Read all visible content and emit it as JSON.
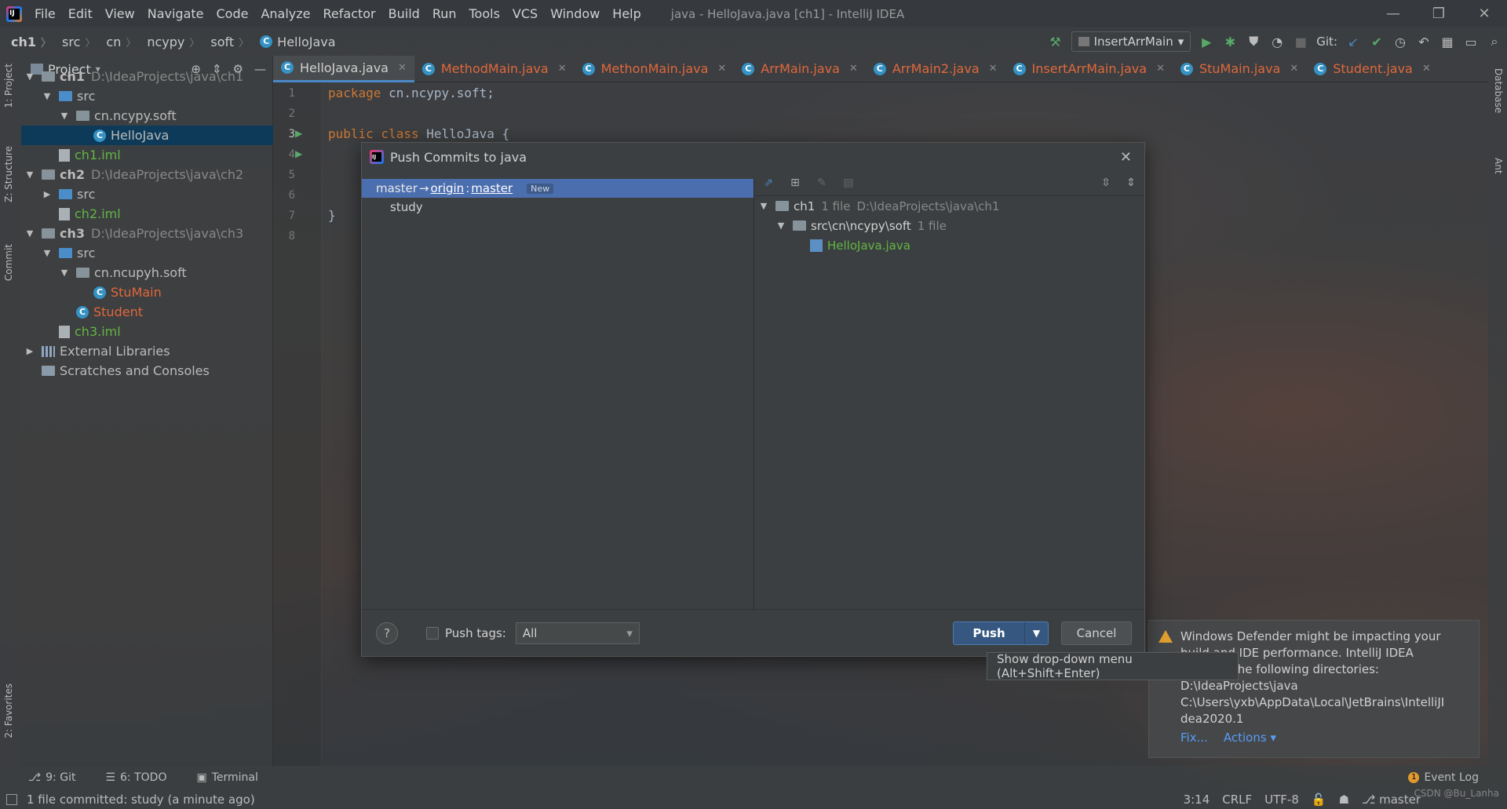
{
  "menubar": {
    "items": [
      "File",
      "Edit",
      "View",
      "Navigate",
      "Code",
      "Analyze",
      "Refactor",
      "Build",
      "Run",
      "Tools",
      "VCS",
      "Window",
      "Help"
    ],
    "window_title": "java - HelloJava.java [ch1] - IntelliJ IDEA"
  },
  "breadcrumb": [
    "ch1",
    "src",
    "cn",
    "ncypy",
    "soft",
    "HelloJava"
  ],
  "toolbar": {
    "run_config": "InsertArrMain",
    "git_label": "Git:"
  },
  "left_strip": {
    "project": "1: Project",
    "structure": "Z: Structure",
    "commit": "Commit",
    "favorites": "2: Favorites"
  },
  "right_strip": {
    "database": "Database",
    "ant": "Ant"
  },
  "project_panel": {
    "title": "Project",
    "tree": [
      {
        "label": "ch1",
        "path": "D:\\IdeaProjects\\java\\ch1",
        "kind": "module",
        "depth": 0,
        "arrow": "▼"
      },
      {
        "label": "src",
        "kind": "src",
        "depth": 1,
        "arrow": "▼"
      },
      {
        "label": "cn.ncypy.soft",
        "kind": "pkg",
        "depth": 2,
        "arrow": "▼"
      },
      {
        "label": "HelloJava",
        "kind": "class",
        "depth": 3,
        "arrow": "",
        "selected": true
      },
      {
        "label": "ch1.iml",
        "kind": "iml",
        "depth": 1,
        "arrow": "",
        "color": "green"
      },
      {
        "label": "ch2",
        "path": "D:\\IdeaProjects\\java\\ch2",
        "kind": "module",
        "depth": 0,
        "arrow": "▼"
      },
      {
        "label": "src",
        "kind": "src",
        "depth": 1,
        "arrow": "▶"
      },
      {
        "label": "ch2.iml",
        "kind": "iml",
        "depth": 1,
        "arrow": "",
        "color": "green"
      },
      {
        "label": "ch3",
        "path": "D:\\IdeaProjects\\java\\ch3",
        "kind": "module",
        "depth": 0,
        "arrow": "▼"
      },
      {
        "label": "src",
        "kind": "src",
        "depth": 1,
        "arrow": "▼"
      },
      {
        "label": "cn.ncupyh.soft",
        "kind": "pkg",
        "depth": 2,
        "arrow": "▼"
      },
      {
        "label": "StuMain",
        "kind": "class",
        "depth": 3,
        "arrow": "",
        "color": "orange"
      },
      {
        "label": "Student",
        "kind": "class",
        "depth": 2,
        "arrow": "",
        "color": "orange"
      },
      {
        "label": "ch3.iml",
        "kind": "iml",
        "depth": 1,
        "arrow": "",
        "color": "green"
      },
      {
        "label": "External Libraries",
        "kind": "lib",
        "depth": 0,
        "arrow": "▶"
      },
      {
        "label": "Scratches and Consoles",
        "kind": "scratch",
        "depth": 0,
        "arrow": ""
      }
    ]
  },
  "editor": {
    "tabs": [
      "HelloJava.java",
      "MethodMain.java",
      "MethonMain.java",
      "ArrMain.java",
      "ArrMain2.java",
      "InsertArrMain.java",
      "StuMain.java",
      "Student.java"
    ],
    "active_tab": 0,
    "line_numbers": [
      "1",
      "2",
      "3",
      "4",
      "5",
      "6",
      "7",
      "8"
    ],
    "code": {
      "l1_kw": "package",
      "l1_rest": " cn.ncypy.soft;",
      "l3_kw": "public class",
      "l3_rest": " HelloJava {",
      "l7": "}"
    }
  },
  "dialog": {
    "title": "Push Commits to java",
    "branch": {
      "local": "master",
      "arrow": "→",
      "remote": "origin",
      "sep": ":",
      "remote_branch": "master",
      "badge": "New"
    },
    "commits": [
      "study"
    ],
    "changes": {
      "root": "ch1",
      "root_count": "1 file",
      "root_path": "D:\\IdeaProjects\\java\\ch1",
      "folder": "src\\cn\\ncypy\\soft",
      "folder_count": "1 file",
      "file": "HelloJava.java"
    },
    "footer": {
      "help": "?",
      "push_tags_label": "Push tags:",
      "push_tags_value": "All",
      "push": "Push",
      "cancel": "Cancel"
    },
    "tooltip": "Show drop-down menu (Alt+Shift+Enter)"
  },
  "notification": {
    "line1": "Windows Defender might be impacting your",
    "line2": "build and IDE performance. IntelliJ IDEA",
    "line3": "checked the following directories:",
    "line4": "D:\\IdeaProjects\\java",
    "line5": "C:\\Users\\yxb\\AppData\\Local\\JetBrains\\IntelliJI",
    "line6": "dea2020.1",
    "fix": "Fix...",
    "actions": "Actions ▾"
  },
  "toolwindows": {
    "git": "9: Git",
    "todo": "6: TODO",
    "terminal": "Terminal",
    "event_log": "Event Log",
    "event_count": "1"
  },
  "status": {
    "message": "1 file committed: study (a minute ago)",
    "position": "3:14",
    "line_sep": "CRLF",
    "encoding": "UTF-8",
    "branch": "master",
    "watermark": "CSDN @Bu_Lanha"
  }
}
